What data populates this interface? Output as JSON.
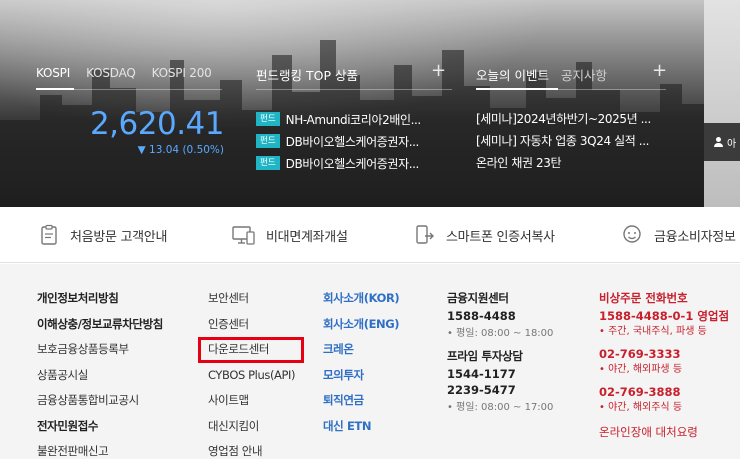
{
  "market": {
    "tabs": [
      {
        "label": "KOSPI",
        "active": true
      },
      {
        "label": "KOSDAQ",
        "active": false
      },
      {
        "label": "KOSPI 200",
        "active": false
      }
    ],
    "value": "2,620.41",
    "change": "▼ 13.04 (0.50%)",
    "color": "#5aa9ff"
  },
  "fund_ranking": {
    "title": "펀드랭킹 TOP 상품",
    "plus": "+",
    "badge": "펀드",
    "items": [
      "NH-Amundi코리아2배인...",
      "DB바이오헬스케어증권자...",
      "DB바이오헬스케어증권자..."
    ]
  },
  "events": {
    "title": "오늘의 이벤트",
    "subtitle": "공지사항",
    "plus": "+",
    "items": [
      "[세미나]2024년하반기~2025년 ...",
      "[세미나] 자동차 업종 3Q24 실적 ...",
      "온라인 채권 23탄"
    ]
  },
  "login_chip": "아",
  "quick_links": [
    {
      "label": "처음방문 고객안내",
      "icon": "clipboard-icon"
    },
    {
      "label": "비대면계좌개설",
      "icon": "monitor-phone-icon"
    },
    {
      "label": "스마트폰 인증서복사",
      "icon": "phone-copy-icon"
    },
    {
      "label": "금융소비자정보",
      "icon": "consumer-icon"
    }
  ],
  "footer": {
    "col1": [
      "개인정보처리방침",
      "이해상충/정보교류차단방침",
      "보호금융상품등록부",
      "상품공시실",
      "금융상품통합비교공시",
      "전자민원접수",
      "불완전판매신고"
    ],
    "col2": [
      "보안센터",
      "인증센터",
      "다운로드센터",
      "CYBOS Plus(API)",
      "사이트맵",
      "대신지킴이",
      "영업점 안내"
    ],
    "col3": [
      "회사소개(KOR)",
      "회사소개(ENG)",
      "크레온",
      "모의투자",
      "퇴직연금",
      "대신 ETN"
    ],
    "support": {
      "title": "금융지원센터",
      "tel": "1588-4488",
      "note": "• 평일: 08:00 ~ 18:00"
    },
    "prime": {
      "title": "프라임 투자상담",
      "tel1": "1544-1177",
      "tel2": "2239-5477",
      "note": "• 평일: 08:00 ~ 17:00"
    },
    "emergency": {
      "title": "비상주문 전화번호",
      "tel1": "1588-4488-0-1 영업점",
      "note1": "• 주간, 국내주식, 파생 등",
      "tel2": "02-769-3333",
      "note2": "• 야간, 해외파생 등",
      "tel3": "02-769-3888",
      "note3": "• 야간, 해외주식 등",
      "more": "온라인장애 대처요령"
    }
  }
}
